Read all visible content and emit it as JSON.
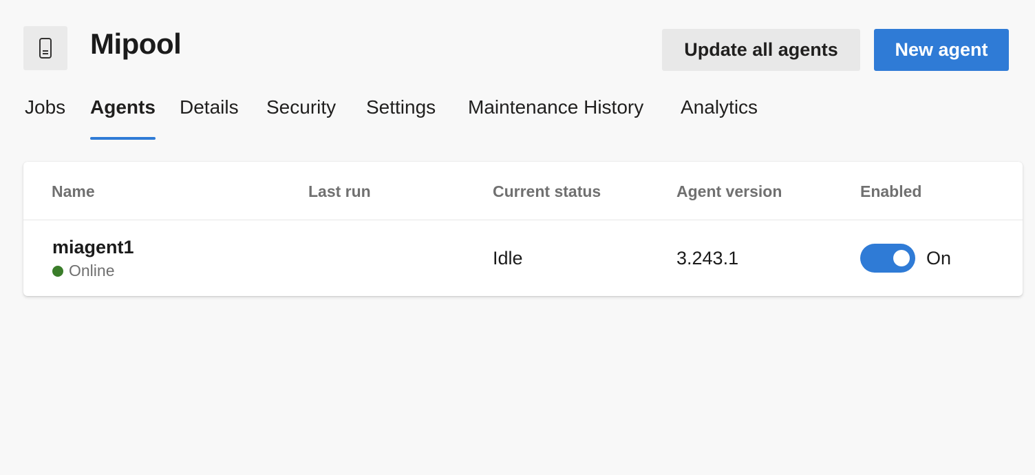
{
  "pool": {
    "title": "Mipool",
    "icon": "agent-pool-icon"
  },
  "actions": {
    "update_all_label": "Update all agents",
    "new_agent_label": "New agent"
  },
  "tabs": [
    {
      "label": "Jobs",
      "selected": false
    },
    {
      "label": "Agents",
      "selected": true
    },
    {
      "label": "Details",
      "selected": false
    },
    {
      "label": "Security",
      "selected": false
    },
    {
      "label": "Settings",
      "selected": false
    },
    {
      "label": "Maintenance History",
      "selected": false
    },
    {
      "label": "Analytics",
      "selected": false
    }
  ],
  "table": {
    "columns": [
      "Name",
      "Last run",
      "Current status",
      "Agent version",
      "Enabled"
    ],
    "rows": [
      {
        "name": "miagent1",
        "state": "Online",
        "last_run": "",
        "current_status": "Idle",
        "agent_version": "3.243.1",
        "enabled": true,
        "enabled_label": "On"
      }
    ]
  },
  "colors": {
    "accent": "#2f7bd6",
    "online": "#3a7d2a",
    "background": "#f8f8f8"
  }
}
